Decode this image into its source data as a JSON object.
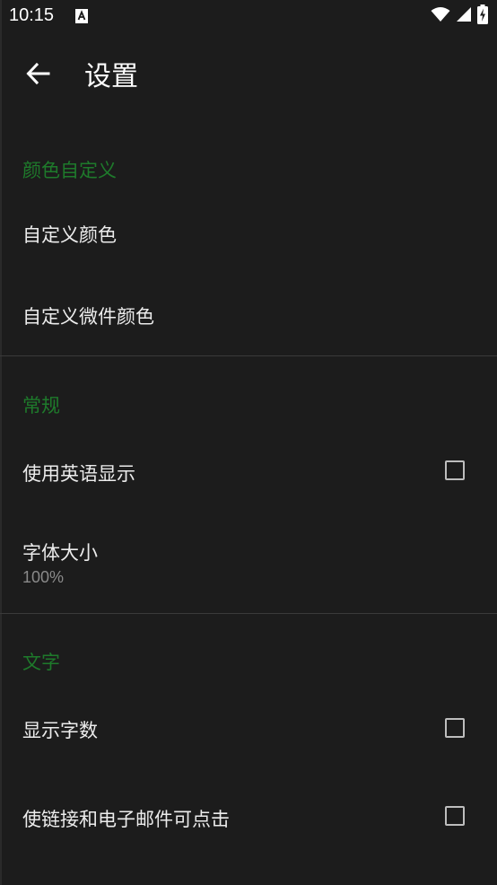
{
  "status_bar": {
    "time": "10:15",
    "notification_icon": "a-notification-icon",
    "wifi_icon": "wifi-icon",
    "signal_icon": "cellular-signal-icon",
    "battery_icon": "battery-charging-icon"
  },
  "app_bar": {
    "title": "设置",
    "back_icon": "arrow-back-icon"
  },
  "colors": {
    "background": "#1c1c1c",
    "accent": "#1e7a2b",
    "text_primary": "#ececec",
    "text_secondary": "#8a8a8a",
    "divider": "#3a3a3a"
  },
  "sections": {
    "color_custom": {
      "header": "颜色自定义",
      "items": [
        {
          "title": "自定义颜色"
        },
        {
          "title": "自定义微件颜色"
        }
      ]
    },
    "general": {
      "header": "常规",
      "items": [
        {
          "title": "使用英语显示",
          "checked": false
        },
        {
          "title": "字体大小",
          "summary": "100%"
        }
      ]
    },
    "text": {
      "header": "文字",
      "items": [
        {
          "title": "显示字数",
          "checked": false
        },
        {
          "title": "使链接和电子邮件可点击",
          "checked": false
        }
      ]
    }
  }
}
